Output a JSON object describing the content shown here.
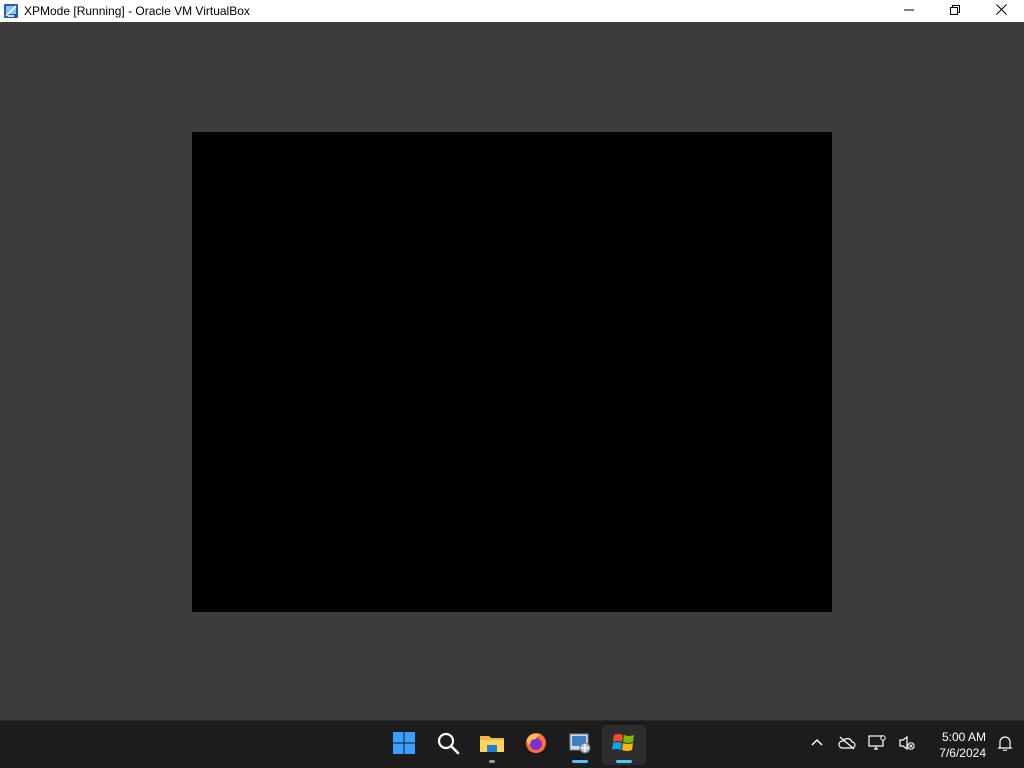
{
  "window": {
    "title": "XPMode [Running] - Oracle VM VirtualBox",
    "controls": {
      "minimize_icon": "minimize-icon",
      "restore_icon": "restore-icon",
      "close_icon": "close-icon"
    }
  },
  "vm": {
    "screen_color": "#000000",
    "background_color": "#3c3c3c"
  },
  "taskbar": {
    "apps": [
      {
        "name": "Start",
        "icon": "windows-start-icon"
      },
      {
        "name": "Search",
        "icon": "search-icon"
      },
      {
        "name": "File Explorer",
        "icon": "folder-icon",
        "running": true
      },
      {
        "name": "Firefox",
        "icon": "firefox-icon"
      },
      {
        "name": "VirtualBox Manager",
        "icon": "virtualbox-icon",
        "running": true
      },
      {
        "name": "XPMode",
        "icon": "windows-xp-icon",
        "running": true,
        "active": true
      }
    ],
    "tray": {
      "icons": [
        "chevron-up-icon",
        "cloud-off-icon",
        "network-icon",
        "volume-muted-icon"
      ],
      "time": "5:00 AM",
      "date": "7/6/2024",
      "notification_icon": "bell-icon"
    },
    "accent_color": "#4cc2ff"
  }
}
